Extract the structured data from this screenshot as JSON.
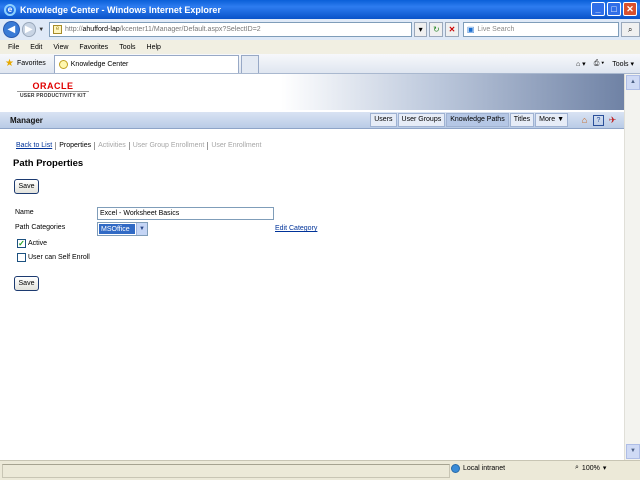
{
  "window": {
    "title": "Knowledge Center - Windows Internet Explorer"
  },
  "browser": {
    "url_prefix": "http://",
    "url_host": "ahufford-lap",
    "url_path": "/kcenter11/Manager/Default.aspx?SelectID=2",
    "search_placeholder": "Live Search",
    "menu": [
      "File",
      "Edit",
      "View",
      "Favorites",
      "Tools",
      "Help"
    ],
    "favorites_label": "Favorites",
    "tab_title": "Knowledge Center",
    "tools_label": "Tools"
  },
  "app": {
    "brand": "ORACLE",
    "brand_sub": "USER PRODUCTIVITY KIT",
    "section_title": "Manager",
    "nav": [
      {
        "label": "Users",
        "active": false
      },
      {
        "label": "User Groups",
        "active": false
      },
      {
        "label": "Knowledge Paths",
        "active": true
      },
      {
        "label": "Titles",
        "active": false
      },
      {
        "label": "More ▼",
        "active": false
      }
    ]
  },
  "subnav": {
    "back": "Back to List",
    "properties": "Properties",
    "activities": "Activities",
    "group_enrollment": "User Group Enrollment",
    "user_enrollment": "User Enrollment"
  },
  "page": {
    "title": "Path Properties",
    "save_label": "Save"
  },
  "form": {
    "name_label": "Name",
    "name_value": "Excel - Worksheet Basics",
    "categories_label": "Path Categories",
    "category_value": "MSOffice",
    "edit_category": "Edit Category",
    "active_label": "Active",
    "active_checked": true,
    "self_enroll_label": "User can Self Enroll",
    "self_enroll_checked": false
  },
  "status": {
    "zone": "Local intranet",
    "zoom": "100%"
  }
}
